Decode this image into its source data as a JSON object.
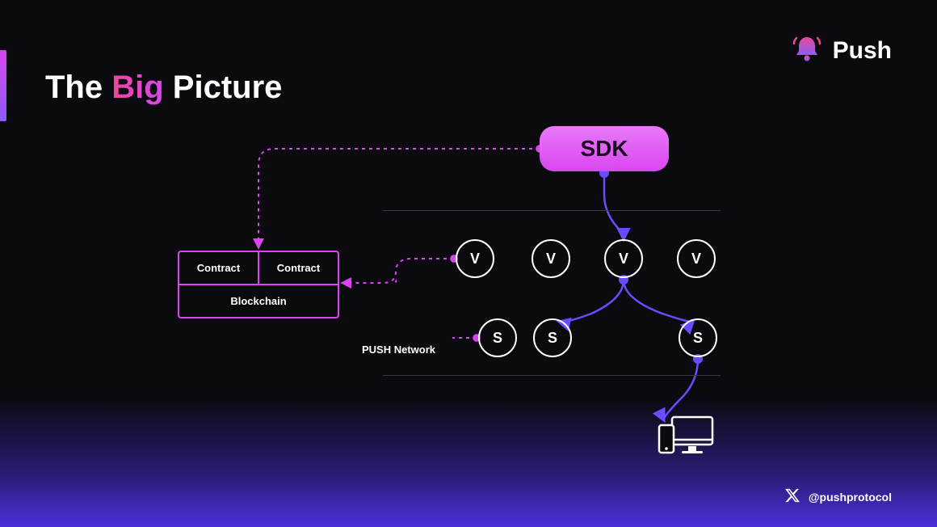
{
  "title": {
    "pre": "The ",
    "highlight": "Big",
    "post": " Picture"
  },
  "brand": {
    "name": "Push"
  },
  "diagram": {
    "sdk_label": "SDK",
    "contract_left": "Contract",
    "contract_right": "Contract",
    "blockchain": "Blockchain",
    "network_label": "PUSH Network",
    "v_nodes": [
      "V",
      "V",
      "V",
      "V"
    ],
    "s_nodes": [
      "S",
      "S",
      "S"
    ]
  },
  "colors": {
    "pink": "#d946ef",
    "purple": "#6d4aff",
    "white": "#ffffff"
  },
  "footer": {
    "handle": "@pushprotocol"
  }
}
